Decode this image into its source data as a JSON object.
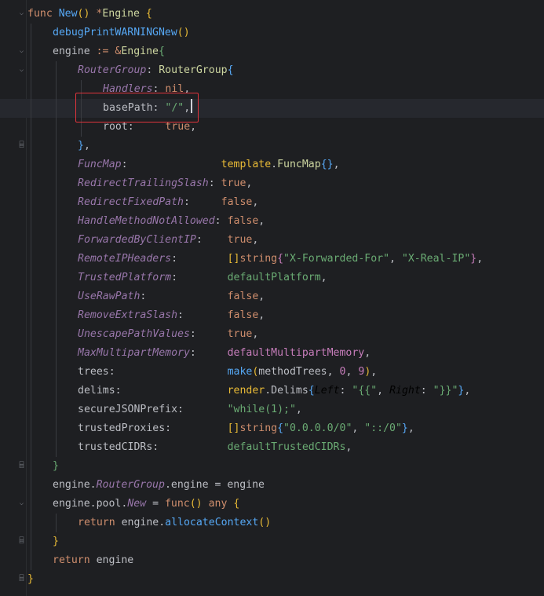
{
  "editor": {
    "language": "Go",
    "lines": [
      {
        "indent": 0,
        "fold": "open",
        "tokens": [
          {
            "t": "func ",
            "c": "k"
          },
          {
            "t": "New",
            "c": "fn"
          },
          {
            "t": "() ",
            "c": "yb"
          },
          {
            "t": "*",
            "c": "k"
          },
          {
            "t": "Engine ",
            "c": "ty"
          },
          {
            "t": "{",
            "c": "yb"
          }
        ]
      },
      {
        "indent": 1,
        "tokens": [
          {
            "t": "debugPrintWARNINGNew",
            "c": "fn"
          },
          {
            "t": "()",
            "c": "yb"
          }
        ]
      },
      {
        "indent": 1,
        "fold": "open",
        "tokens": [
          {
            "t": "engine ",
            "c": "t"
          },
          {
            "t": ":= ",
            "c": "k"
          },
          {
            "t": "&",
            "c": "k"
          },
          {
            "t": "Engine",
            "c": "ty"
          },
          {
            "t": "{",
            "c": "gr"
          }
        ]
      },
      {
        "indent": 2,
        "fold": "open",
        "tokens": [
          {
            "t": "RouterGroup",
            "c": "f"
          },
          {
            "t": ": ",
            "c": "t"
          },
          {
            "t": "RouterGroup",
            "c": "ty"
          },
          {
            "t": "{",
            "c": "bl"
          }
        ]
      },
      {
        "indent": 3,
        "tokens": [
          {
            "t": "Handlers",
            "c": "f"
          },
          {
            "t": ": ",
            "c": "t"
          },
          {
            "t": "nil",
            "c": "k"
          },
          {
            "t": ",",
            "c": "t"
          }
        ]
      },
      {
        "indent": 3,
        "current": true,
        "tokens": [
          {
            "t": "basePath",
            "c": "c"
          },
          {
            "t": ": ",
            "c": "t"
          },
          {
            "t": "\"/\"",
            "c": "s"
          },
          {
            "t": ",",
            "c": "t"
          }
        ]
      },
      {
        "indent": 3,
        "tokens": [
          {
            "t": "root",
            "c": "c"
          },
          {
            "t": ":     ",
            "c": "t"
          },
          {
            "t": "true",
            "c": "k"
          },
          {
            "t": ",",
            "c": "t"
          }
        ]
      },
      {
        "indent": 2,
        "fold": "close",
        "tokens": [
          {
            "t": "}",
            "c": "bl"
          },
          {
            "t": ",",
            "c": "t"
          }
        ]
      },
      {
        "indent": 2,
        "tokens": [
          {
            "t": "FuncMap",
            "c": "f"
          },
          {
            "t": ":               ",
            "c": "t"
          },
          {
            "t": "template",
            "c": "yb"
          },
          {
            "t": ".",
            "c": "t"
          },
          {
            "t": "FuncMap",
            "c": "ty"
          },
          {
            "t": "{}",
            "c": "bl"
          },
          {
            "t": ",",
            "c": "t"
          }
        ]
      },
      {
        "indent": 2,
        "tokens": [
          {
            "t": "RedirectTrailingSlash",
            "c": "f"
          },
          {
            "t": ": ",
            "c": "t"
          },
          {
            "t": "true",
            "c": "k"
          },
          {
            "t": ",",
            "c": "t"
          }
        ]
      },
      {
        "indent": 2,
        "tokens": [
          {
            "t": "RedirectFixedPath",
            "c": "f"
          },
          {
            "t": ":     ",
            "c": "t"
          },
          {
            "t": "false",
            "c": "k"
          },
          {
            "t": ",",
            "c": "t"
          }
        ]
      },
      {
        "indent": 2,
        "tokens": [
          {
            "t": "HandleMethodNotAllowed",
            "c": "f"
          },
          {
            "t": ": ",
            "c": "t"
          },
          {
            "t": "false",
            "c": "k"
          },
          {
            "t": ",",
            "c": "t"
          }
        ]
      },
      {
        "indent": 2,
        "tokens": [
          {
            "t": "ForwardedByClientIP",
            "c": "f"
          },
          {
            "t": ":    ",
            "c": "t"
          },
          {
            "t": "true",
            "c": "k"
          },
          {
            "t": ",",
            "c": "t"
          }
        ]
      },
      {
        "indent": 2,
        "tokens": [
          {
            "t": "RemoteIPHeaders",
            "c": "f"
          },
          {
            "t": ":        ",
            "c": "t"
          },
          {
            "t": "[]",
            "c": "yb"
          },
          {
            "t": "string",
            "c": "k"
          },
          {
            "t": "{",
            "c": "pk"
          },
          {
            "t": "\"X-Forwarded-For\"",
            "c": "s"
          },
          {
            "t": ", ",
            "c": "t"
          },
          {
            "t": "\"X-Real-IP\"",
            "c": "s"
          },
          {
            "t": "}",
            "c": "pk"
          },
          {
            "t": ",",
            "c": "t"
          }
        ]
      },
      {
        "indent": 2,
        "tokens": [
          {
            "t": "TrustedPlatform",
            "c": "f"
          },
          {
            "t": ":        ",
            "c": "t"
          },
          {
            "t": "defaultPlatform",
            "c": "gr"
          },
          {
            "t": ",",
            "c": "t"
          }
        ]
      },
      {
        "indent": 2,
        "tokens": [
          {
            "t": "UseRawPath",
            "c": "f"
          },
          {
            "t": ":             ",
            "c": "t"
          },
          {
            "t": "false",
            "c": "k"
          },
          {
            "t": ",",
            "c": "t"
          }
        ]
      },
      {
        "indent": 2,
        "tokens": [
          {
            "t": "RemoveExtraSlash",
            "c": "f"
          },
          {
            "t": ":       ",
            "c": "t"
          },
          {
            "t": "false",
            "c": "k"
          },
          {
            "t": ",",
            "c": "t"
          }
        ]
      },
      {
        "indent": 2,
        "tokens": [
          {
            "t": "UnescapePathValues",
            "c": "f"
          },
          {
            "t": ":     ",
            "c": "t"
          },
          {
            "t": "true",
            "c": "k"
          },
          {
            "t": ",",
            "c": "t"
          }
        ]
      },
      {
        "indent": 2,
        "tokens": [
          {
            "t": "MaxMultipartMemory",
            "c": "f"
          },
          {
            "t": ":     ",
            "c": "t"
          },
          {
            "t": "defaultMultipartMemory",
            "c": "pk"
          },
          {
            "t": ",",
            "c": "t"
          }
        ]
      },
      {
        "indent": 2,
        "tokens": [
          {
            "t": "trees",
            "c": "c"
          },
          {
            "t": ":                  ",
            "c": "t"
          },
          {
            "t": "make",
            "c": "fn"
          },
          {
            "t": "(",
            "c": "yb"
          },
          {
            "t": "methodTrees",
            "c": "t"
          },
          {
            "t": ", ",
            "c": "t"
          },
          {
            "t": "0",
            "c": "pk"
          },
          {
            "t": ", ",
            "c": "t"
          },
          {
            "t": "9",
            "c": "pk"
          },
          {
            "t": ")",
            "c": "yb"
          },
          {
            "t": ",",
            "c": "t"
          }
        ]
      },
      {
        "indent": 2,
        "tokens": [
          {
            "t": "delims",
            "c": "c"
          },
          {
            "t": ":                 ",
            "c": "t"
          },
          {
            "t": "render",
            "c": "yb"
          },
          {
            "t": ".",
            "c": "t"
          },
          {
            "t": "Delims",
            "c": "t"
          },
          {
            "t": "{",
            "c": "bl"
          },
          {
            "t": "Left",
            "c": "it"
          },
          {
            "t": ": ",
            "c": "t"
          },
          {
            "t": "\"{{\"",
            "c": "s"
          },
          {
            "t": ", ",
            "c": "t"
          },
          {
            "t": "Right",
            "c": "it"
          },
          {
            "t": ": ",
            "c": "t"
          },
          {
            "t": "\"}}\"",
            "c": "s"
          },
          {
            "t": "}",
            "c": "bl"
          },
          {
            "t": ",",
            "c": "t"
          }
        ]
      },
      {
        "indent": 2,
        "tokens": [
          {
            "t": "secureJSONPrefix",
            "c": "c"
          },
          {
            "t": ":       ",
            "c": "t"
          },
          {
            "t": "\"while(1);\"",
            "c": "s"
          },
          {
            "t": ",",
            "c": "t"
          }
        ]
      },
      {
        "indent": 2,
        "tokens": [
          {
            "t": "trustedProxies",
            "c": "c"
          },
          {
            "t": ":         ",
            "c": "t"
          },
          {
            "t": "[]",
            "c": "yb"
          },
          {
            "t": "string",
            "c": "k"
          },
          {
            "t": "{",
            "c": "bl"
          },
          {
            "t": "\"0.0.0.0/0\"",
            "c": "s"
          },
          {
            "t": ", ",
            "c": "t"
          },
          {
            "t": "\"::/0\"",
            "c": "s"
          },
          {
            "t": "}",
            "c": "bl"
          },
          {
            "t": ",",
            "c": "t"
          }
        ]
      },
      {
        "indent": 2,
        "tokens": [
          {
            "t": "trustedCIDRs",
            "c": "c"
          },
          {
            "t": ":           ",
            "c": "t"
          },
          {
            "t": "defaultTrustedCIDRs",
            "c": "gr"
          },
          {
            "t": ",",
            "c": "t"
          }
        ]
      },
      {
        "indent": 1,
        "fold": "close",
        "tokens": [
          {
            "t": "}",
            "c": "gr"
          }
        ]
      },
      {
        "indent": 1,
        "tokens": [
          {
            "t": "engine",
            "c": "t"
          },
          {
            "t": ".",
            "c": "t"
          },
          {
            "t": "RouterGroup",
            "c": "f"
          },
          {
            "t": ".",
            "c": "t"
          },
          {
            "t": "engine",
            "c": "t"
          },
          {
            "t": " = ",
            "c": "t"
          },
          {
            "t": "engine",
            "c": "t"
          }
        ]
      },
      {
        "indent": 1,
        "fold": "open",
        "tokens": [
          {
            "t": "engine",
            "c": "t"
          },
          {
            "t": ".",
            "c": "t"
          },
          {
            "t": "pool",
            "c": "t"
          },
          {
            "t": ".",
            "c": "t"
          },
          {
            "t": "New",
            "c": "f"
          },
          {
            "t": " = ",
            "c": "t"
          },
          {
            "t": "func",
            "c": "k"
          },
          {
            "t": "() ",
            "c": "yb"
          },
          {
            "t": "any ",
            "c": "k"
          },
          {
            "t": "{",
            "c": "yb"
          }
        ]
      },
      {
        "indent": 2,
        "tokens": [
          {
            "t": "return ",
            "c": "k"
          },
          {
            "t": "engine",
            "c": "t"
          },
          {
            "t": ".",
            "c": "t"
          },
          {
            "t": "allocateContext",
            "c": "fn"
          },
          {
            "t": "()",
            "c": "yb"
          }
        ]
      },
      {
        "indent": 1,
        "fold": "close",
        "tokens": [
          {
            "t": "}",
            "c": "yb"
          }
        ]
      },
      {
        "indent": 1,
        "tokens": [
          {
            "t": "return ",
            "c": "k"
          },
          {
            "t": "engine",
            "c": "t"
          }
        ]
      },
      {
        "indent": 0,
        "fold": "close",
        "tokens": [
          {
            "t": "}",
            "c": "yb"
          }
        ]
      }
    ]
  }
}
